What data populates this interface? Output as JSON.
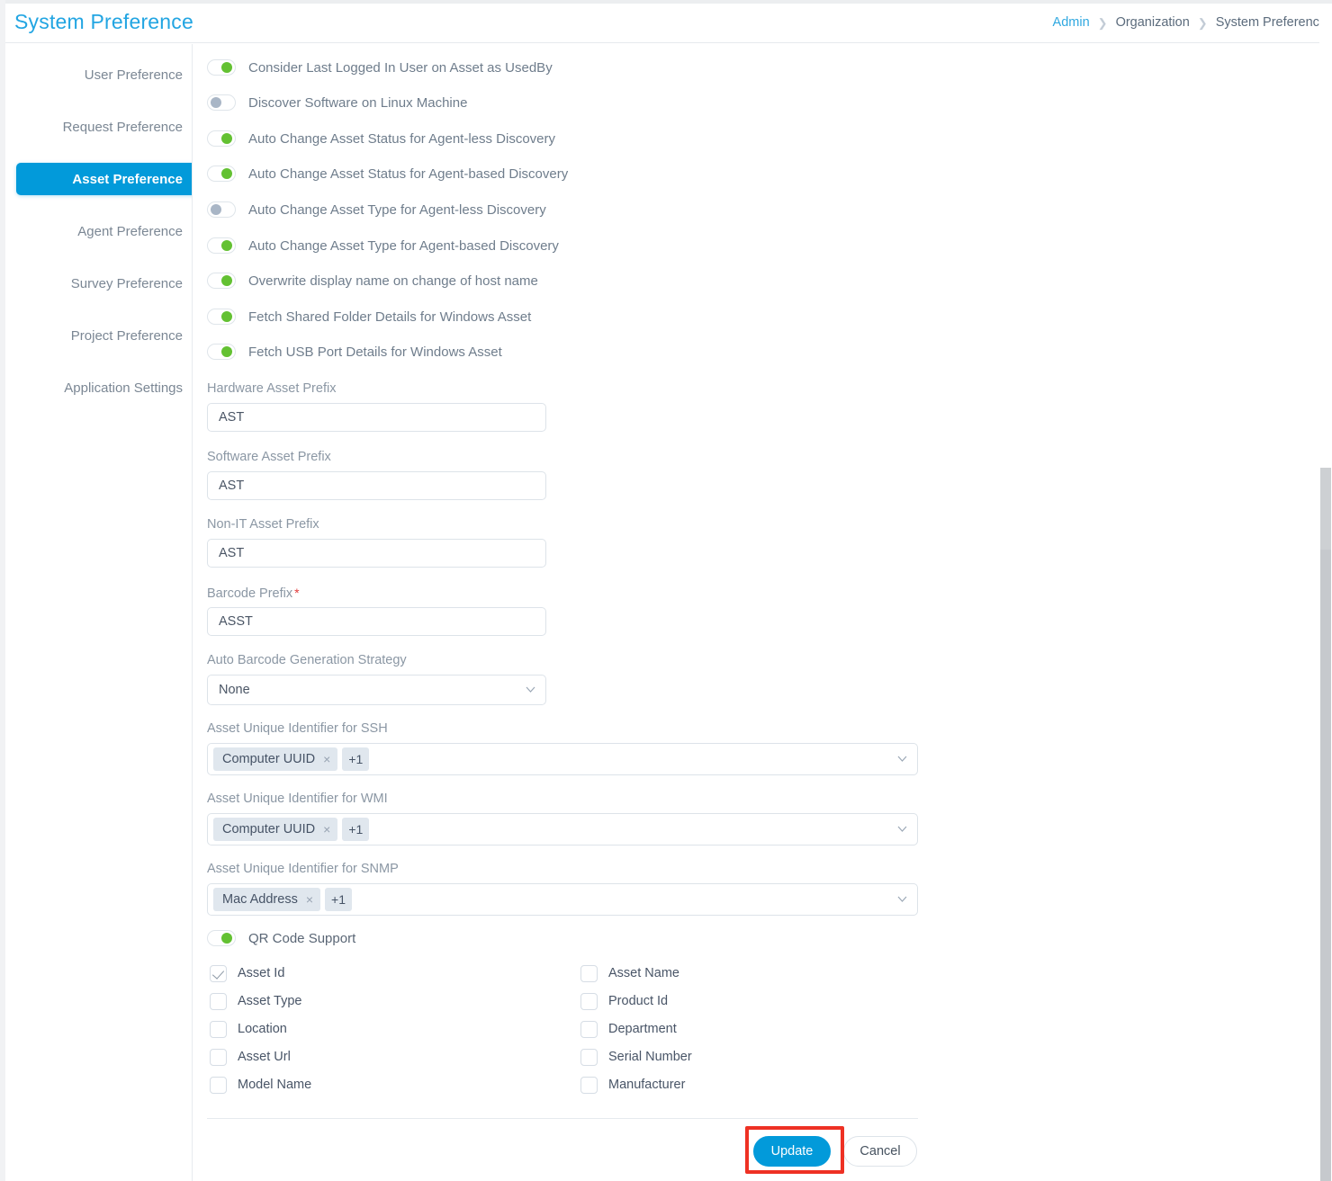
{
  "header": {
    "title": "System Preference",
    "breadcrumb": [
      {
        "label": "Admin",
        "type": "link"
      },
      {
        "label": "Organization",
        "type": "text"
      },
      {
        "label": "System Preference",
        "type": "text"
      }
    ],
    "separator": "❯"
  },
  "sidebar": {
    "items": [
      {
        "label": "User Preference",
        "active": false
      },
      {
        "label": "Request Preference",
        "active": false
      },
      {
        "label": "Asset Preference",
        "active": true
      },
      {
        "label": "Agent Preference",
        "active": false
      },
      {
        "label": "Survey Preference",
        "active": false
      },
      {
        "label": "Project Preference",
        "active": false
      },
      {
        "label": "Application Settings",
        "active": false
      }
    ]
  },
  "main": {
    "toggles": [
      {
        "label": "Consider Last Logged In User on Asset as UsedBy",
        "state": "on"
      },
      {
        "label": "Discover Software on Linux Machine",
        "state": "off"
      },
      {
        "label": "Auto Change Asset Status for Agent-less Discovery",
        "state": "on"
      },
      {
        "label": "Auto Change Asset Status for Agent-based Discovery",
        "state": "on"
      },
      {
        "label": "Auto Change Asset Type for Agent-less Discovery",
        "state": "off"
      },
      {
        "label": "Auto Change Asset Type for Agent-based Discovery",
        "state": "on"
      },
      {
        "label": "Overwrite display name on change of host name",
        "state": "on"
      },
      {
        "label": "Fetch Shared Folder Details for Windows Asset",
        "state": "on"
      },
      {
        "label": "Fetch USB Port Details for Windows Asset",
        "state": "on"
      }
    ],
    "text_fields": [
      {
        "label": "Hardware Asset Prefix",
        "value": "AST",
        "placeholder": "",
        "required": false
      },
      {
        "label": "Software Asset Prefix",
        "value": "AST",
        "placeholder": "",
        "required": false
      },
      {
        "label": "Non-IT Asset Prefix",
        "value": "AST",
        "placeholder": "",
        "required": false
      },
      {
        "label": "Barcode Prefix",
        "value": "ASST",
        "placeholder": "",
        "required": true
      }
    ],
    "barcode_strategy": {
      "label": "Auto Barcode Generation Strategy",
      "value": "None"
    },
    "unique_identifiers": [
      {
        "label": "Asset Unique Identifier for SSH",
        "chip": "Computer UUID",
        "remove": "×",
        "more": "+1"
      },
      {
        "label": "Asset Unique Identifier for WMI",
        "chip": "Computer UUID",
        "remove": "×",
        "more": "+1"
      },
      {
        "label": "Asset Unique Identifier for SNMP",
        "chip": "Mac Address",
        "remove": "×",
        "more": "+1"
      }
    ],
    "qr_toggle": {
      "label": "QR Code Support",
      "state": "on"
    },
    "qr_fields_left": [
      {
        "label": "Asset Id",
        "checked": true
      },
      {
        "label": "Asset Type",
        "checked": false
      },
      {
        "label": "Location",
        "checked": false
      },
      {
        "label": "Asset Url",
        "checked": false
      },
      {
        "label": "Model Name",
        "checked": false
      }
    ],
    "qr_fields_right": [
      {
        "label": "Asset Name",
        "checked": false
      },
      {
        "label": "Product Id",
        "checked": false
      },
      {
        "label": "Department",
        "checked": false
      },
      {
        "label": "Serial Number",
        "checked": false
      },
      {
        "label": "Manufacturer",
        "checked": false
      }
    ],
    "footer": {
      "update_label": "Update",
      "cancel_label": "Cancel"
    }
  },
  "colors": {
    "accent": "#029ada",
    "title": "#22a5e2",
    "toggle_on": "#63c132",
    "toggle_off": "#a9b6c6",
    "required_star": "#e13b3b",
    "highlight": "#ee3124",
    "chip_bg": "#e0e7ee"
  }
}
